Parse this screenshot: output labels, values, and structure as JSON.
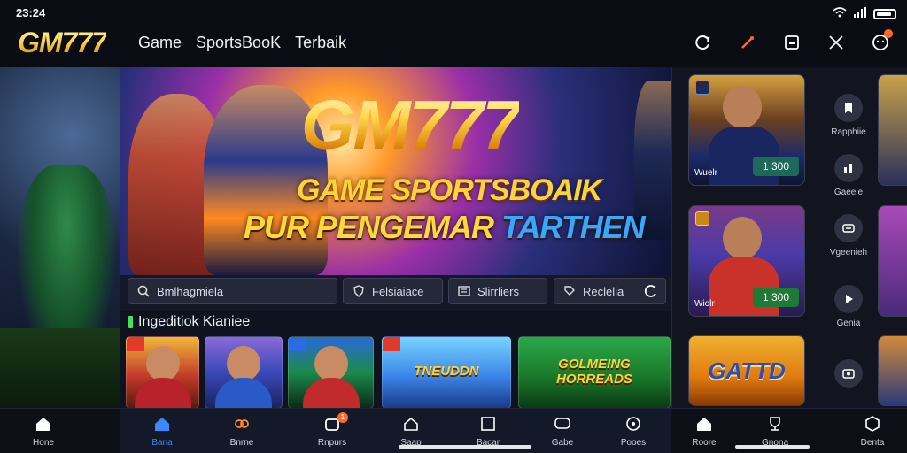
{
  "status": {
    "time": "23:24"
  },
  "header": {
    "logo": "GM777",
    "nav": [
      "Game",
      "SportsBooK",
      "Terbaik"
    ]
  },
  "hero": {
    "title": "GM777",
    "line1": "GAME SPORTSBOAIK",
    "line2a": "PUR PENGEMAR",
    "line2b": " TARTHEN"
  },
  "filters": {
    "search_placeholder": "Bmlhagmiela",
    "f2": "Felsiaiace",
    "f3": "Slirrliers",
    "f4": "Reclelia"
  },
  "section": {
    "title": "Ingeditiok Kianiee",
    "cards": [
      {
        "text": ""
      },
      {
        "text": ""
      },
      {
        "text": ""
      },
      {
        "text": "TNEUDDN"
      },
      {
        "text": "GOLMEING HORREADS"
      }
    ]
  },
  "right": {
    "cards": [
      {
        "label": "Wuelr",
        "price": "1 300"
      },
      {
        "label": "Wiolr",
        "price": "1 300"
      },
      {
        "label": "",
        "text": "GATTD"
      }
    ],
    "quick": [
      {
        "icon": "bookmark-icon",
        "label": "Rapphiie"
      },
      {
        "icon": "chart-icon",
        "label": "Gaeeie"
      },
      {
        "icon": "ticket-icon",
        "label": "Vgeenieh"
      },
      {
        "icon": "play-icon",
        "label": "Genia"
      },
      {
        "icon": "camera-icon",
        "label": ""
      }
    ]
  },
  "bottom": {
    "items": [
      {
        "icon": "home-icon",
        "label": "Hone"
      },
      {
        "icon": "home-icon",
        "label": "Bana",
        "active": true
      },
      {
        "icon": "gamepad-icon",
        "label": "Bnrne"
      },
      {
        "icon": "bag-icon",
        "label": "Rnpurs",
        "badge": "1"
      },
      {
        "icon": "home-outline-icon",
        "label": "Saap"
      },
      {
        "icon": "square-icon",
        "label": "Bacar"
      },
      {
        "icon": "chat-icon",
        "label": "Gabe"
      },
      {
        "icon": "compass-icon",
        "label": "Pooes"
      },
      {
        "icon": "home-icon",
        "label": "Roore"
      },
      {
        "icon": "trophy-icon",
        "label": "Gnona"
      },
      {
        "icon": "box-icon",
        "label": "Denta"
      }
    ]
  },
  "colors": {
    "accent_gold": "#ffd23a",
    "accent_blue": "#3a8aff",
    "accent_green": "#47e05a",
    "badge_orange": "#ff6a2b"
  }
}
